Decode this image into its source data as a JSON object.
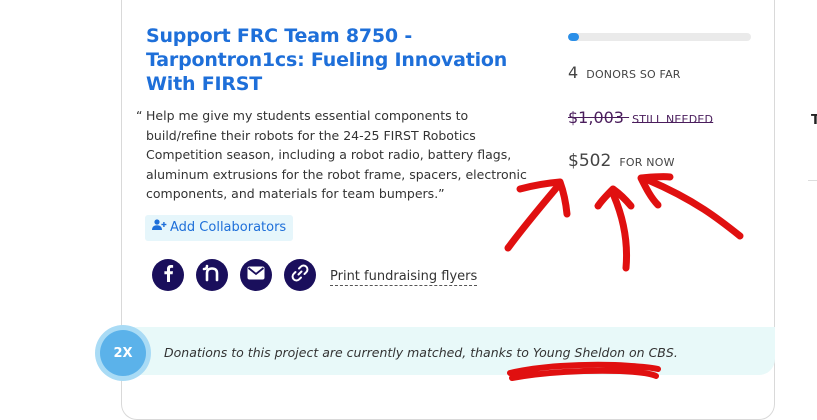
{
  "project": {
    "title": "Support FRC Team 8750 - Tarpontron1cs: Fueling Innovation With FIRST",
    "quote_open": "“",
    "quote": "Help me give my students essential components to build/refine their robots for the 24-25 FIRST Robotics Competition season, including a robot radio, battery flags, aluminum extrusions for the robot frame, spacers, electronic components, and materials for team bumpers.”"
  },
  "actions": {
    "add_collaborators": "Add Collaborators",
    "share_icons": [
      "facebook-icon",
      "nextdoor-icon",
      "email-icon",
      "link-icon"
    ],
    "print_flyers": "Print fundraising flyers"
  },
  "stats": {
    "progress_fraction": 0.06,
    "donors_count": "4",
    "donors_label": "DONORS SO FAR",
    "still_needed_amount": "$1,003",
    "still_needed_label": "STILL NEEDED",
    "for_now_amount": "$502",
    "for_now_label": "FOR NOW"
  },
  "match": {
    "badge": "2X",
    "text": "Donations to this project are currently matched, thanks to Young Sheldon on CBS."
  },
  "edge_letter": "T",
  "colors": {
    "title_blue": "#1e6fd9",
    "share_navy": "#1a0f5c",
    "progress_blue": "#2b8fe8",
    "match_bg": "#e8f9f9",
    "annotation_red": "#e01010"
  }
}
